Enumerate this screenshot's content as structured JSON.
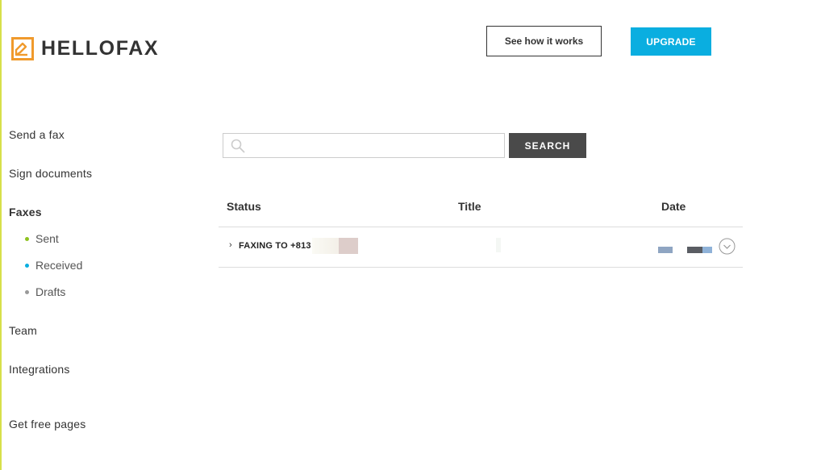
{
  "brand": {
    "name": "HELLOFAX",
    "color": "#f09a2c"
  },
  "header": {
    "how_label": "See how it works",
    "upgrade_label": "UPGRADE",
    "upgrade_color": "#0aaee0"
  },
  "sidebar": {
    "items": [
      {
        "label": "Send a fax"
      },
      {
        "label": "Sign documents"
      },
      {
        "label": "Faxes"
      },
      {
        "label": "Team"
      },
      {
        "label": "Integrations"
      },
      {
        "label": "Get free pages"
      }
    ],
    "subitems": [
      {
        "label": "Sent",
        "dot_color": "#8ec21f"
      },
      {
        "label": "Received",
        "dot_color": "#0aaee0"
      },
      {
        "label": "Drafts",
        "dot_color": "#999999"
      }
    ]
  },
  "search": {
    "placeholder": "",
    "value": "",
    "button_label": "SEARCH"
  },
  "table": {
    "columns": [
      "Status",
      "Title",
      "Date"
    ],
    "rows": [
      {
        "status": "FAXING TO +813",
        "title": "",
        "date": ""
      }
    ]
  }
}
